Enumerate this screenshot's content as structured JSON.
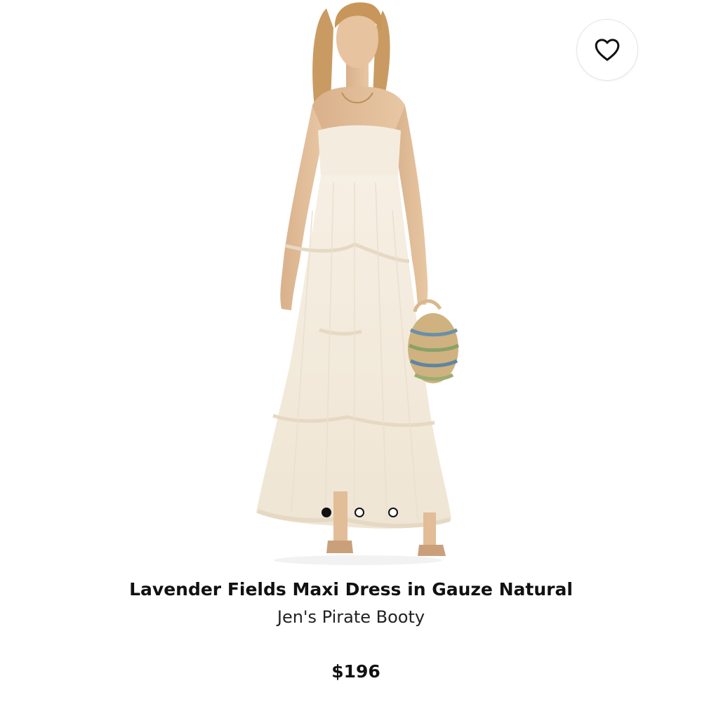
{
  "product": {
    "title": "Lavender Fields Maxi Dress in Gauze Natural",
    "brand": "Jen's Pirate Booty",
    "price": "$196",
    "image_icon": "product-photo",
    "favorite_icon": "heart-outline-icon"
  },
  "carousel": {
    "total": 3,
    "active_index": 0
  },
  "colors": {
    "text": "#111111",
    "dress": "#f3ebdd",
    "skin": "#e4c09c",
    "hair": "#c99b62"
  }
}
